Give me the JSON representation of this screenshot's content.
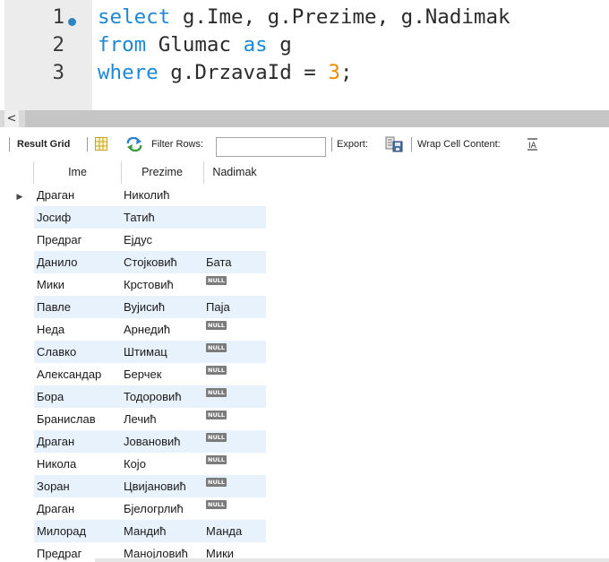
{
  "editor": {
    "lines": [
      {
        "number": "1",
        "tokens": [
          {
            "text": "select",
            "type": "kw"
          },
          {
            "text": " g.Ime, g.Prezime, g.Nadimak",
            "type": "ident"
          }
        ]
      },
      {
        "number": "2",
        "tokens": [
          {
            "text": "from",
            "type": "kw"
          },
          {
            "text": " Glumac ",
            "type": "ident"
          },
          {
            "text": "as",
            "type": "kw"
          },
          {
            "text": " g",
            "type": "ident"
          }
        ]
      },
      {
        "number": "3",
        "tokens": [
          {
            "text": "where",
            "type": "kw"
          },
          {
            "text": " g.DrzavaId = ",
            "type": "ident"
          },
          {
            "text": "3",
            "type": "num"
          },
          {
            "text": ";",
            "type": "ident"
          }
        ]
      }
    ]
  },
  "scrollbar": {
    "left_arrow": "<"
  },
  "toolbar": {
    "result_grid_label": "Result Grid",
    "filter_label": "Filter Rows:",
    "filter_value": "",
    "export_label": "Export:",
    "wrap_label": "Wrap Cell Content:"
  },
  "icons": {
    "grid": "grid-icon",
    "refresh": "refresh-icon",
    "export": "export-icon",
    "wrap": "wrap-icon",
    "row_pointer": "row-pointer-icon"
  },
  "colors": {
    "keyword": "#1e88d6",
    "number": "#f08a00",
    "alt_row": "#e8f2fd",
    "null_badge": "#7b7b7b"
  },
  "table": {
    "columns": [
      "Ime",
      "Prezime",
      "Nadimak"
    ],
    "null_label": "NULL",
    "rows": [
      {
        "ime": "Драган",
        "prezime": "Николић",
        "nadimak": ""
      },
      {
        "ime": "Јосиф",
        "prezime": "Татић",
        "nadimak": ""
      },
      {
        "ime": "Предраг",
        "prezime": "Ејдус",
        "nadimak": ""
      },
      {
        "ime": "Данило",
        "prezime": "Стојковић",
        "nadimak": "Бата"
      },
      {
        "ime": "Мики",
        "prezime": "Крстовић",
        "nadimak": null
      },
      {
        "ime": "Павле",
        "prezime": "Вујисић",
        "nadimak": "Паја"
      },
      {
        "ime": "Неда",
        "prezime": "Арнедић",
        "nadimak": null
      },
      {
        "ime": "Славко",
        "prezime": "Штимац",
        "nadimak": null
      },
      {
        "ime": "Александар",
        "prezime": "Берчек",
        "nadimak": null
      },
      {
        "ime": "Бора",
        "prezime": "Тодоровић",
        "nadimak": null
      },
      {
        "ime": "Бранислав",
        "prezime": "Лечић",
        "nadimak": null
      },
      {
        "ime": "Драган",
        "prezime": "Јовановић",
        "nadimak": null
      },
      {
        "ime": "Никола",
        "prezime": "Којо",
        "nadimak": null
      },
      {
        "ime": "Зоран",
        "prezime": "Цвијановић",
        "nadimak": null
      },
      {
        "ime": "Драган",
        "prezime": "Бјелогрлић",
        "nadimak": null
      },
      {
        "ime": "Милорад",
        "prezime": "Мандић",
        "nadimak": "Манда"
      },
      {
        "ime": "Предраг",
        "prezime": "Манојловић",
        "nadimak": "Мики"
      }
    ]
  }
}
